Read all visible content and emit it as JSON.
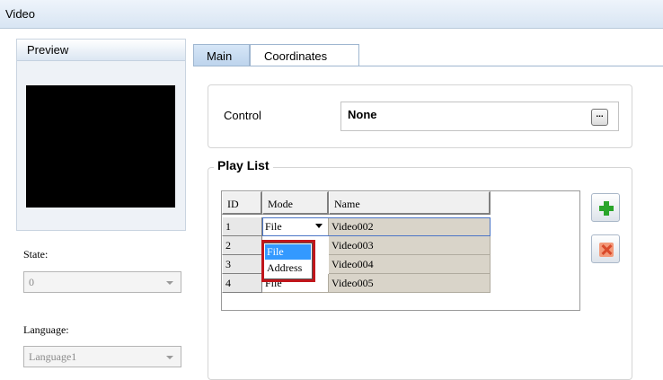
{
  "window": {
    "title": "Video"
  },
  "preview": {
    "label": "Preview"
  },
  "state": {
    "label": "State:",
    "value": "0"
  },
  "language": {
    "label": "Language:",
    "value": "Language1"
  },
  "tabs": [
    {
      "label": "Main",
      "active": true
    },
    {
      "label": "Coordinates",
      "active": false
    }
  ],
  "control": {
    "label": "Control",
    "value": "None",
    "browse_label": "..."
  },
  "playlist": {
    "title": "Play List",
    "columns": [
      "ID",
      "Mode",
      "Name"
    ],
    "rows": [
      {
        "id": "1",
        "mode": "File",
        "name": "Video002"
      },
      {
        "id": "2",
        "mode": "",
        "name": "Video003"
      },
      {
        "id": "3",
        "mode": "",
        "name": "Video004"
      },
      {
        "id": "4",
        "mode": "File",
        "name": "Video005"
      }
    ],
    "mode_options": [
      "File",
      "Address"
    ],
    "highlighted_option": "File"
  },
  "buttons": {
    "add_icon": "plus-icon",
    "delete_icon": "delete-x-icon"
  },
  "colors": {
    "highlight": "#c0161b",
    "selection": "#3399ff",
    "add_green": "#2aa52a"
  }
}
